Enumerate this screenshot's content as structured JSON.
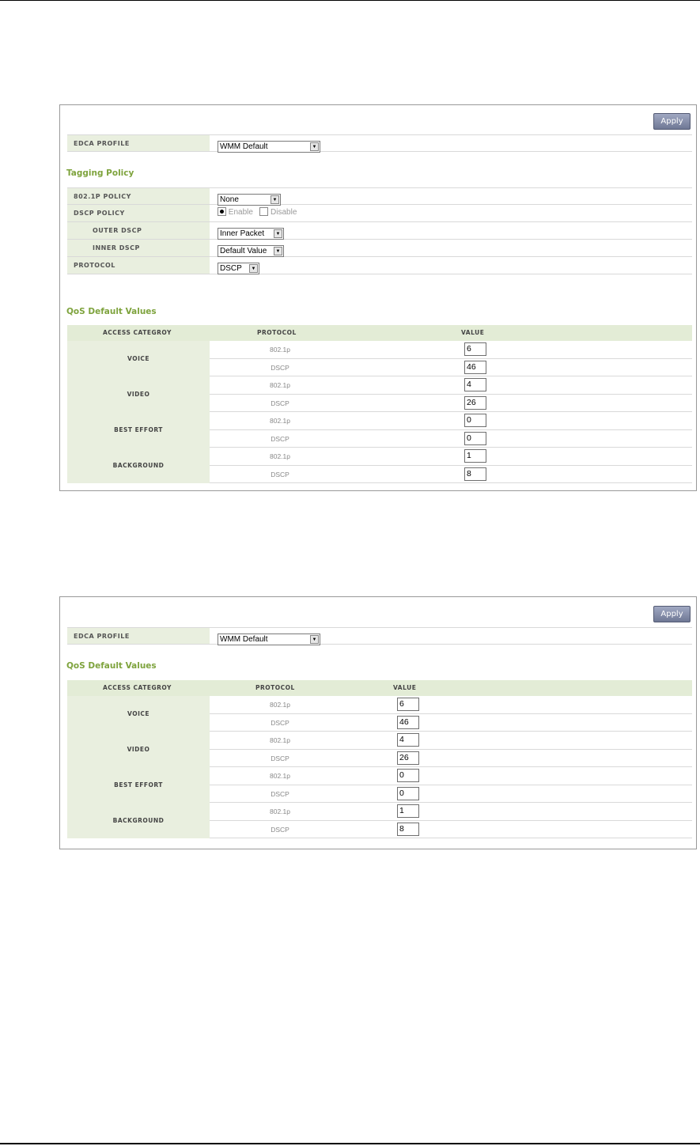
{
  "panel1": {
    "apply_label": "Apply",
    "edca": {
      "label": "EDCA PROFILE",
      "value": "WMM Default"
    },
    "tagging_title": "Tagging Policy",
    "tagging": {
      "p8021_label": "802.1P POLICY",
      "p8021_value": "None",
      "dscp_label": "DSCP POLICY",
      "dscp_enable": "Enable",
      "dscp_disable": "Disable",
      "outer_label": "OUTER DSCP",
      "outer_value": "Inner Packet",
      "inner_label": "INNER DSCP",
      "inner_value": "Default Value",
      "protocol_label": "PROTOCOL",
      "protocol_value": "DSCP"
    },
    "qos_title": "QoS Default Values",
    "qos_headers": {
      "category": "ACCESS CATEGROY",
      "protocol": "PROTOCOL",
      "value": "VALUE"
    },
    "qos": [
      {
        "category": "VOICE",
        "rows": [
          {
            "protocol": "802.1p",
            "value": "6"
          },
          {
            "protocol": "DSCP",
            "value": "46"
          }
        ]
      },
      {
        "category": "VIDEO",
        "rows": [
          {
            "protocol": "802.1p",
            "value": "4"
          },
          {
            "protocol": "DSCP",
            "value": "26"
          }
        ]
      },
      {
        "category": "BEST EFFORT",
        "rows": [
          {
            "protocol": "802.1p",
            "value": "0"
          },
          {
            "protocol": "DSCP",
            "value": "0"
          }
        ]
      },
      {
        "category": "BACKGROUND",
        "rows": [
          {
            "protocol": "802.1p",
            "value": "1"
          },
          {
            "protocol": "DSCP",
            "value": "8"
          }
        ]
      }
    ]
  },
  "panel2": {
    "apply_label": "Apply",
    "edca": {
      "label": "EDCA PROFILE",
      "value": "WMM Default"
    },
    "qos_title": "QoS Default Values",
    "qos_headers": {
      "category": "ACCESS CATEGROY",
      "protocol": "PROTOCOL",
      "value": "VALUE"
    },
    "qos": [
      {
        "category": "VOICE",
        "rows": [
          {
            "protocol": "802.1p",
            "value": "6"
          },
          {
            "protocol": "DSCP",
            "value": "46"
          }
        ]
      },
      {
        "category": "VIDEO",
        "rows": [
          {
            "protocol": "802.1p",
            "value": "4"
          },
          {
            "protocol": "DSCP",
            "value": "26"
          }
        ]
      },
      {
        "category": "BEST EFFORT",
        "rows": [
          {
            "protocol": "802.1p",
            "value": "0"
          },
          {
            "protocol": "DSCP",
            "value": "0"
          }
        ]
      },
      {
        "category": "BACKGROUND",
        "rows": [
          {
            "protocol": "802.1p",
            "value": "1"
          },
          {
            "protocol": "DSCP",
            "value": "8"
          }
        ]
      }
    ]
  }
}
